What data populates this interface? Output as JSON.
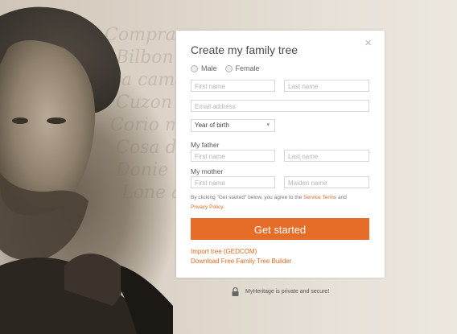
{
  "modal": {
    "title": "Create my family tree",
    "close_icon": "×",
    "gender_male": "Male",
    "gender_female": "Female",
    "first_name_placeholder": "First name",
    "last_name_placeholder": "Last name",
    "email_placeholder": "Email address",
    "year_of_birth_label": "Year of birth",
    "father_label": "My father",
    "father_first_placeholder": "First name",
    "father_last_placeholder": "Last name",
    "mother_label": "My mother",
    "mother_first_placeholder": "First name",
    "mother_maiden_placeholder": "Maiden name",
    "terms_prefix": "By clicking \"Get started\" below, you agree to the",
    "terms_link": "Service Terms",
    "terms_and": "and",
    "privacy_link": "Privacy Policy",
    "terms_suffix": ".",
    "cta": "Get started",
    "import_link": "Import tree (GEDCOM)",
    "download_link": "Download Free Family Tree Builder"
  },
  "footer": {
    "secure_text": "MyHeritage is private and secure!",
    "lock_icon": "lock-icon"
  },
  "colors": {
    "accent": "#e56d28",
    "link": "#e0681f"
  }
}
